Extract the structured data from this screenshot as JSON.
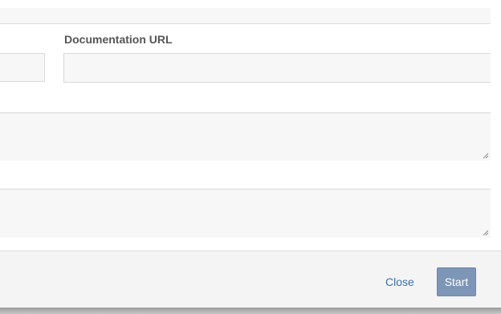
{
  "form": {
    "documentation_url": {
      "label": "Documentation URL",
      "value": "",
      "placeholder": ""
    }
  },
  "footer": {
    "close_label": "Close",
    "start_label": "Start"
  },
  "colors": {
    "field_background": "#f7f7f7",
    "link": "#3a6fb0",
    "primary_button": "#7d95b6"
  },
  "icons": [
    "resize-grip-icon"
  ]
}
